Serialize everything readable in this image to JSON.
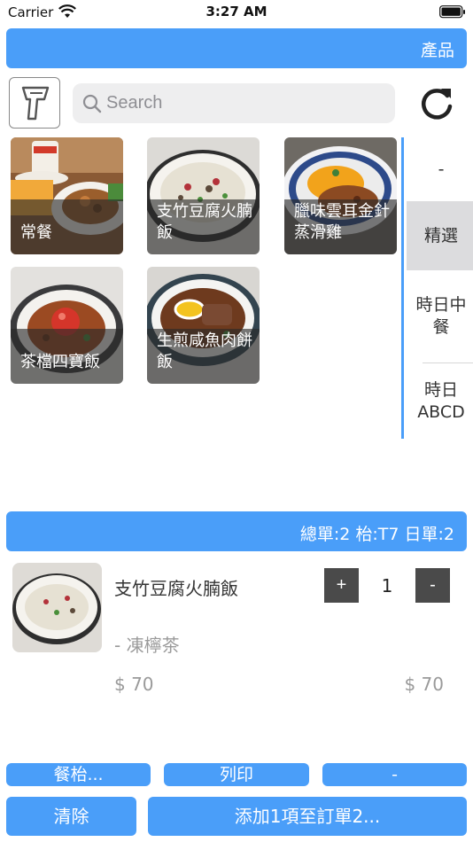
{
  "status_bar": {
    "carrier": "Carrier",
    "time": "3:27 AM"
  },
  "header": {
    "title": "產品"
  },
  "search": {
    "placeholder": "Search",
    "value": ""
  },
  "products": [
    {
      "name": "常餐",
      "icon": "food-photo"
    },
    {
      "name": "支竹豆腐火腩飯",
      "icon": "food-photo"
    },
    {
      "name": "臘味雲耳金針蒸滑雞",
      "icon": "food-photo"
    },
    {
      "name": "茶檔四寶飯",
      "icon": "food-photo"
    },
    {
      "name": "生煎咸魚肉餅飯",
      "icon": "food-photo"
    }
  ],
  "categories": [
    {
      "label": "-",
      "selected": false
    },
    {
      "label": "精選",
      "selected": true
    },
    {
      "label": "時日中餐",
      "selected": false
    },
    {
      "label": "時日ABCD",
      "selected": false
    }
  ],
  "order": {
    "summary": "總單:2 枱:T7 日單:2",
    "items": [
      {
        "name": "支竹豆腐火腩飯",
        "option": "- 凍檸茶",
        "unit_price": "$ 70",
        "total_price": "$ 70",
        "quantity": "1",
        "plus_label": "+",
        "minus_label": "-"
      }
    ]
  },
  "actions": {
    "table_label": "餐枱...",
    "print_label": "列印",
    "other_label": "-",
    "clear_label": "清除",
    "add_label": "添加1項至訂單2..."
  },
  "colors": {
    "accent": "#4a9ef9",
    "stepper": "#4a4a4a",
    "selected_category": "#dcdcde"
  }
}
